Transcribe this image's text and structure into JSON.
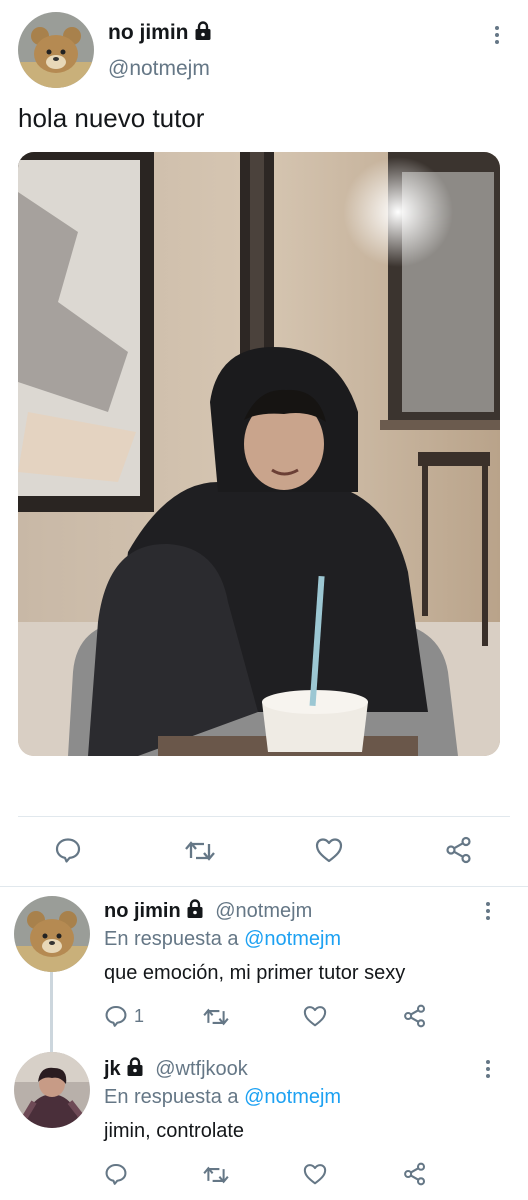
{
  "main_tweet": {
    "display_name": "no jimin",
    "handle": "@notmejm",
    "text": "hola nuevo tutor",
    "avatar_icon": "teddy-bear-avatar",
    "protected_icon": "lock-icon"
  },
  "main_actions": {
    "reply_icon": "reply-icon",
    "retweet_icon": "retweet-icon",
    "like_icon": "heart-icon",
    "share_icon": "share-icon"
  },
  "replies": [
    {
      "display_name": "no jimin",
      "handle": "@notmejm",
      "in_reply_prefix": "En respuesta a",
      "in_reply_to": "@notmejm",
      "text": "que emoción, mi primer tutor sexy",
      "reply_count": "1",
      "avatar_icon": "teddy-bear-avatar"
    },
    {
      "display_name": "jk",
      "handle": "@wtfjkook",
      "in_reply_prefix": "En respuesta a",
      "in_reply_to": "@notmejm",
      "text": "jimin, controlate",
      "reply_count": "",
      "avatar_icon": "person-avatar"
    }
  ],
  "colors": {
    "link": "#1da1f2",
    "secondary_text": "#657786",
    "divider": "#e1e8ed"
  }
}
